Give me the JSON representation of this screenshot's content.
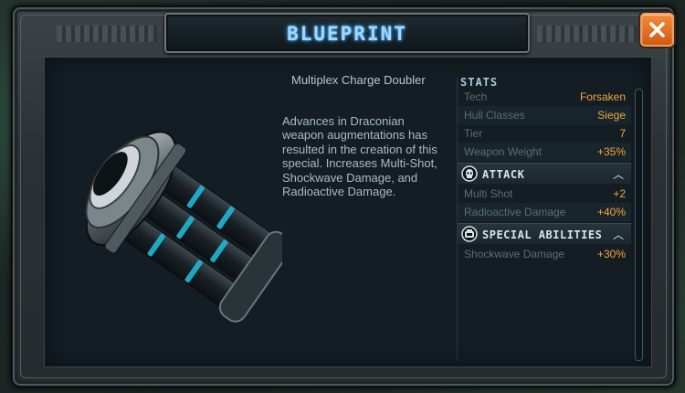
{
  "dialog": {
    "title": "BLUEPRINT",
    "close_icon": "close-x-icon",
    "accent_color": "#9fd8ff",
    "close_color": "#e8722a"
  },
  "item": {
    "name": "Multiplex Charge Doubler",
    "description": "Advances in Draconian weapon augmentations has resulted in the creation of this special.  Increases Multi-Shot, Shockwave Damage, and Radioactive Damage.",
    "image_icon": "weapon-module-icon"
  },
  "stats": {
    "header": "STATS",
    "general": [
      {
        "label": "Tech",
        "value": "Forsaken"
      },
      {
        "label": "Hull Classes",
        "value": "Siege"
      },
      {
        "label": "Tier",
        "value": "7"
      },
      {
        "label": "Weapon Weight",
        "value": "+35%"
      }
    ],
    "sections": [
      {
        "title": "ATTACK",
        "icon": "attack-skull-icon",
        "rows": [
          {
            "label": "Multi Shot",
            "value": "+2"
          },
          {
            "label": "Radioactive Damage",
            "value": "+40%"
          }
        ]
      },
      {
        "title": "SPECIAL ABILITIES",
        "icon": "special-abilities-icon",
        "rows": [
          {
            "label": "Shockwave Damage",
            "value": "+30%"
          }
        ]
      }
    ],
    "value_color": "#f2a73a"
  }
}
